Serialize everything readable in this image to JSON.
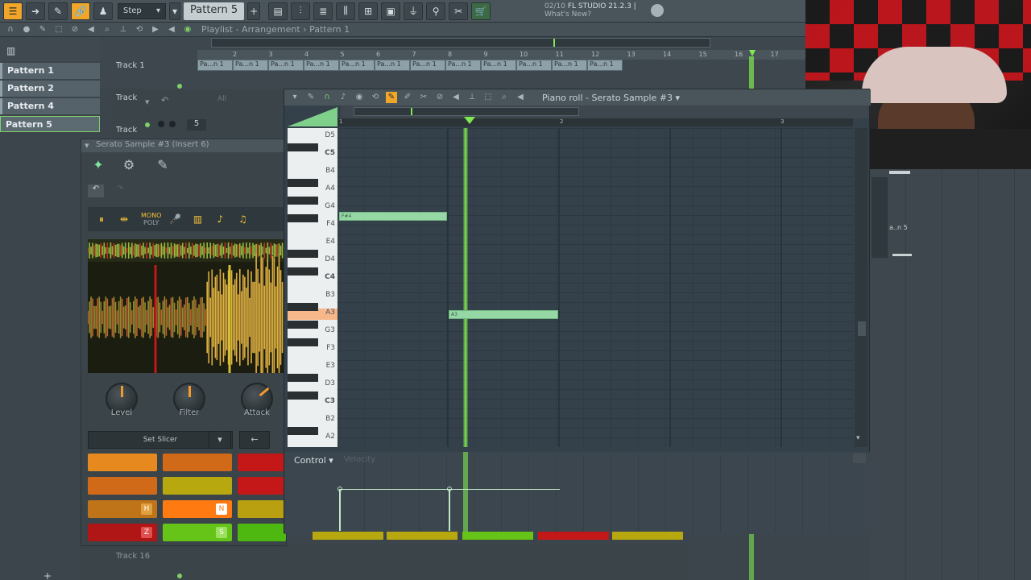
{
  "toolbar": {
    "snap_label": "Step",
    "pattern_label": "Pattern 5",
    "plus_label": "+",
    "news_date": "02/10",
    "news_title": "FL STUDIO 21.2.3 |",
    "news_subtitle": "What's New?"
  },
  "playlist": {
    "title": "Playlist - Arrangement",
    "pattern_crumb": "Pattern 1",
    "ruler": [
      "2",
      "3",
      "4",
      "5",
      "6",
      "7",
      "8",
      "9",
      "10",
      "11",
      "12",
      "13",
      "14",
      "15",
      "16",
      "17"
    ],
    "track1_label": "Track 1",
    "track2_label": "Track",
    "track3_label": "Track",
    "track16_label": "Track 16",
    "clip_label": "Pa...n 1",
    "right_clip_label": "a..n 5",
    "all_label": "All",
    "channel_number": "5"
  },
  "patterns": [
    {
      "label": "Pattern 1"
    },
    {
      "label": "Pattern 2"
    },
    {
      "label": "Pattern 4"
    },
    {
      "label": "Pattern 5"
    }
  ],
  "sampler": {
    "title": "Serato Sample #3 (Insert 6)",
    "mono_label": "MONO",
    "poly_label": "POLY",
    "knobs": [
      {
        "label": "Level"
      },
      {
        "label": "Filter"
      },
      {
        "label": "Attack"
      }
    ],
    "slicer_label": "Set Slicer",
    "pad_keys": [
      "H",
      "N",
      "Z",
      "S"
    ],
    "colors": {
      "pad_orange": "#e68a20",
      "pad_darkorange": "#d06a18",
      "pad_red": "#c41818",
      "pad_yellow": "#b8a810",
      "pad_bright_orange": "#ff7a10",
      "pad_green": "#66c418"
    }
  },
  "pianoroll": {
    "title": "Piano roll - Serato Sample #3",
    "ruler": [
      "1",
      "2",
      "3"
    ],
    "keys": [
      "D5",
      "C5",
      "B4",
      "A4",
      "G4",
      "F4",
      "E4",
      "D4",
      "C4",
      "B3",
      "A3",
      "G3",
      "F3",
      "E3",
      "D3",
      "C3",
      "B2",
      "A2"
    ],
    "notes": [
      {
        "label": "F#4"
      },
      {
        "label": "A3"
      }
    ],
    "control_label": "Control",
    "velocity_label": "Velocity",
    "colors": {
      "note": "#95d8a6",
      "playhead": "#7fe850",
      "highlight_key": "#f6b78a"
    }
  }
}
